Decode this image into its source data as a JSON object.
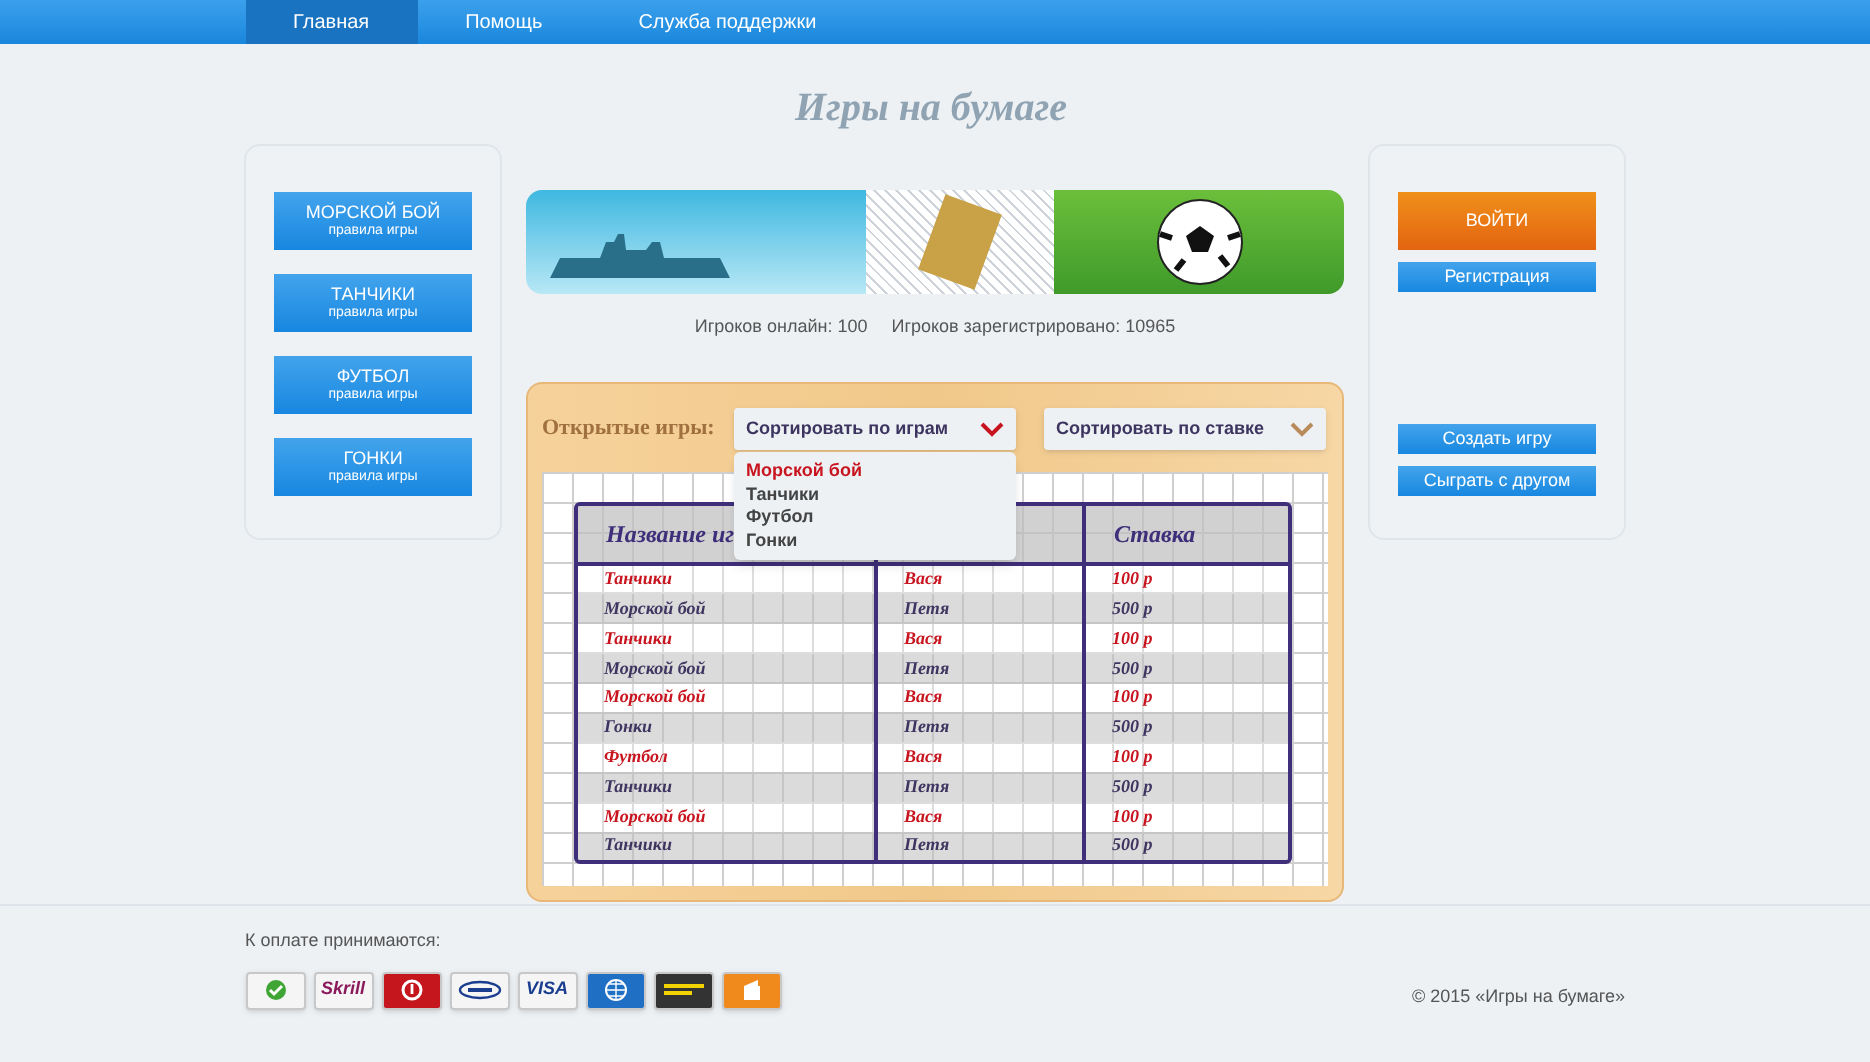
{
  "nav": [
    {
      "label": "Главная",
      "selected": true
    },
    {
      "label": "Помощь",
      "selected": false
    },
    {
      "label": "Служба поддержки",
      "selected": false
    }
  ],
  "site_title": "Игры на бумаге",
  "rules_menu": [
    {
      "title": "МОРСКОЙ БОЙ",
      "subtitle": "правила игры"
    },
    {
      "title": "ТАНЧИКИ",
      "subtitle": "правила игры"
    },
    {
      "title": "ФУТБОЛ",
      "subtitle": "правила игры"
    },
    {
      "title": "ГОНКИ",
      "subtitle": "правила игры"
    }
  ],
  "stats": [
    "Игроков онлайн: 100",
    "Игроков зарегистрировано: 10965"
  ],
  "open_games": {
    "label": "Открытые игры:",
    "sorts": [
      {
        "label": "Сортировать по играм",
        "expanded": true,
        "options": [
          {
            "label": "Морской бой",
            "selected": true
          },
          {
            "label": "Танчики",
            "selected": false
          },
          {
            "label": "Футбол",
            "selected": false
          },
          {
            "label": "Гонки",
            "selected": false
          }
        ]
      },
      {
        "label": "Сортировать по ставке",
        "expanded": false
      }
    ],
    "columns": [
      "Название иг",
      "Ставка"
    ],
    "rows": [
      {
        "game": "Танчики",
        "player": "Вася",
        "bet": "100 р",
        "highlighted": true
      },
      {
        "game": "Морской бой",
        "player": "Петя",
        "bet": "500 р",
        "highlighted": false
      },
      {
        "game": "Танчики",
        "player": "Вася",
        "bet": "100 р",
        "highlighted": true
      },
      {
        "game": "Морской бой",
        "player": "Петя",
        "bet": "500 р",
        "highlighted": false
      },
      {
        "game": "Морской бой",
        "player": "Вася",
        "bet": "100 р",
        "highlighted": true
      },
      {
        "game": "Гонки",
        "player": "Петя",
        "bet": "500 р",
        "highlighted": false
      },
      {
        "game": "Футбол",
        "player": "Вася",
        "bet": "100 р",
        "highlighted": true
      },
      {
        "game": "Танчики",
        "player": "Петя",
        "bet": "500 р",
        "highlighted": false
      },
      {
        "game": "Морской бой",
        "player": "Вася",
        "bet": "100 р",
        "highlighted": true
      },
      {
        "game": "Танчики",
        "player": "Петя",
        "bet": "500 р",
        "highlighted": false
      }
    ]
  },
  "account": {
    "login": "ВОЙТИ",
    "register": "Регистрация",
    "actions": [
      "Создать игру",
      "Сыграть с другом"
    ]
  },
  "footer": {
    "payments_label": "К оплате принимаются:",
    "payments": [
      {
        "kind": "sber"
      },
      {
        "kind": "text",
        "text": "Skrill",
        "color": "#8b1a5c"
      },
      {
        "kind": "qiwi"
      },
      {
        "kind": "ukash"
      },
      {
        "kind": "text",
        "text": "VISA",
        "color": "#1a3d8f"
      },
      {
        "kind": "webmoney"
      },
      {
        "kind": "western"
      },
      {
        "kind": "yandex"
      }
    ],
    "copyright": "© 2015 «Игры на бумаге»"
  }
}
